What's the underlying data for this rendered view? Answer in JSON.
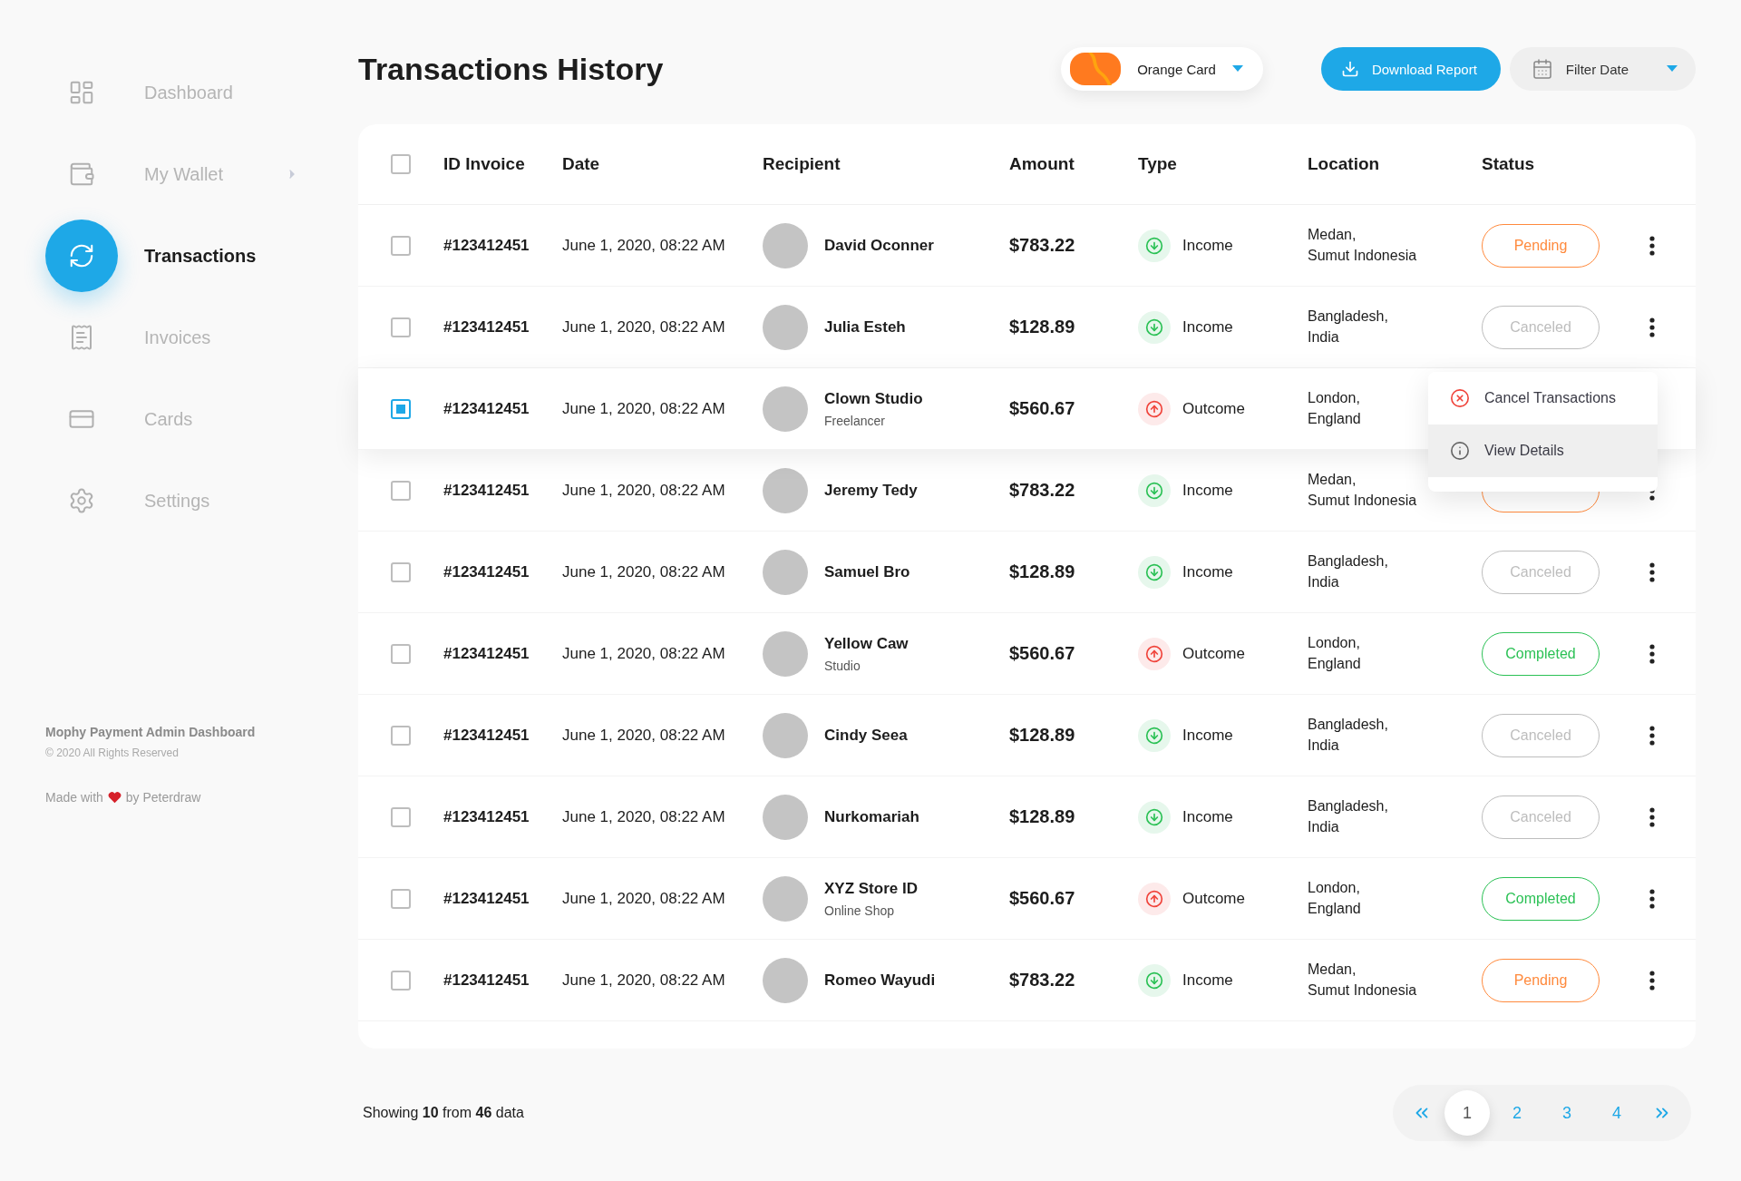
{
  "sidebar": {
    "items": [
      {
        "label": "Dashboard",
        "selected": false,
        "expandable": false
      },
      {
        "label": "My Wallet",
        "selected": false,
        "expandable": true
      },
      {
        "label": "Transactions",
        "selected": true,
        "expandable": false
      },
      {
        "label": "Invoices",
        "selected": false,
        "expandable": false
      },
      {
        "label": "Cards",
        "selected": false,
        "expandable": false
      },
      {
        "label": "Settings",
        "selected": false,
        "expandable": false
      }
    ],
    "footer": {
      "title": "Mophy Payment Admin Dashboard",
      "copyright": "© 2020 All Rights Reserved",
      "made_with": "Made with",
      "by": "by Peterdraw"
    }
  },
  "header": {
    "title": "Transactions History",
    "card_select": {
      "label": "Orange Card"
    },
    "download_button": "Download Report",
    "filter_date": {
      "label": "Filter Date"
    }
  },
  "table": {
    "columns": [
      "ID Invoice",
      "Date",
      "Recipient",
      "Amount",
      "Type",
      "Location",
      "Status"
    ],
    "all_checked": false,
    "rows": [
      {
        "checked": false,
        "selected": false,
        "id": "#123412451",
        "date": "June 1, 2020, 08:22 AM",
        "recipient": "David Oconner",
        "amount": "$783.22",
        "type": {
          "kind": "income",
          "label": "Income"
        },
        "location": [
          "Medan,",
          "Sumut Indonesia"
        ],
        "status": {
          "kind": "pending",
          "label": "Pending"
        },
        "actions": true
      },
      {
        "checked": false,
        "selected": false,
        "id": "#123412451",
        "date": "June 1, 2020, 08:22 AM",
        "recipient": "Julia Esteh",
        "amount": "$128.89",
        "type": {
          "kind": "income",
          "label": "Income"
        },
        "location": [
          "Bangladesh,",
          "India"
        ],
        "status": {
          "kind": "canceled",
          "label": "Canceled"
        },
        "actions": true
      },
      {
        "checked": true,
        "selected": true,
        "id": "#123412451",
        "date": "June 1, 2020, 08:22 AM",
        "recipient": "Clown Studio",
        "subtitle": "Freelancer",
        "amount": "$560.67",
        "type": {
          "kind": "outcome",
          "label": "Outcome"
        },
        "location": [
          "London,",
          "England"
        ],
        "actions": false
      },
      {
        "checked": false,
        "selected": false,
        "id": "#123412451",
        "date": "June 1, 2020, 08:22 AM",
        "recipient": "Jeremy Tedy",
        "amount": "$783.22",
        "type": {
          "kind": "income",
          "label": "Income"
        },
        "location": [
          "Medan,",
          "Sumut Indonesia"
        ],
        "status": {
          "kind": "pending"
        },
        "actions": true
      },
      {
        "checked": false,
        "selected": false,
        "id": "#123412451",
        "date": "June 1, 2020, 08:22 AM",
        "recipient": "Samuel Bro",
        "amount": "$128.89",
        "type": {
          "kind": "income",
          "label": "Income"
        },
        "location": [
          "Bangladesh,",
          "India"
        ],
        "status": {
          "kind": "canceled",
          "label": "Canceled"
        },
        "actions": true
      },
      {
        "checked": false,
        "selected": false,
        "id": "#123412451",
        "date": "June 1, 2020, 08:22 AM",
        "recipient": "Yellow Caw",
        "subtitle": "Studio",
        "amount": "$560.67",
        "type": {
          "kind": "outcome",
          "label": "Outcome"
        },
        "location": [
          "London,",
          "England"
        ],
        "status": {
          "kind": "completed",
          "label": "Completed"
        },
        "actions": true
      },
      {
        "checked": false,
        "selected": false,
        "id": "#123412451",
        "date": "June 1, 2020, 08:22 AM",
        "recipient": "Cindy Seea",
        "amount": "$128.89",
        "type": {
          "kind": "income",
          "label": "Income"
        },
        "location": [
          "Bangladesh,",
          "India"
        ],
        "status": {
          "kind": "canceled",
          "label": "Canceled"
        },
        "actions": true
      },
      {
        "checked": false,
        "selected": false,
        "id": "#123412451",
        "date": "June 1, 2020, 08:22 AM",
        "recipient": "Nurkomariah",
        "amount": "$128.89",
        "type": {
          "kind": "income",
          "label": "Income"
        },
        "location": [
          "Bangladesh,",
          "India"
        ],
        "status": {
          "kind": "canceled",
          "label": "Canceled"
        },
        "actions": true
      },
      {
        "checked": false,
        "selected": false,
        "id": "#123412451",
        "date": "June 1, 2020, 08:22 AM",
        "recipient": "XYZ Store ID",
        "subtitle": "Online Shop",
        "amount": "$560.67",
        "type": {
          "kind": "outcome",
          "label": "Outcome"
        },
        "location": [
          "London,",
          "England"
        ],
        "status": {
          "kind": "completed",
          "label": "Completed"
        },
        "actions": true
      },
      {
        "checked": false,
        "selected": false,
        "id": "#123412451",
        "date": "June 1, 2020, 08:22 AM",
        "recipient": "Romeo Wayudi",
        "amount": "$783.22",
        "type": {
          "kind": "income",
          "label": "Income"
        },
        "location": [
          "Medan,",
          "Sumut Indonesia"
        ],
        "status": {
          "kind": "pending",
          "label": "Pending"
        },
        "actions": true
      }
    ],
    "context_menu": {
      "items": [
        {
          "kind": "cancel",
          "label": "Cancel Transactions",
          "selected": false
        },
        {
          "kind": "details",
          "label": "View Details",
          "selected": true
        }
      ]
    }
  },
  "footer": {
    "summary": "Showing **10** from **46** data",
    "pages": [
      {
        "label": "1",
        "selected": true
      },
      {
        "label": "2",
        "selected": false
      },
      {
        "label": "3",
        "selected": false
      },
      {
        "label": "4",
        "selected": false
      }
    ]
  }
}
